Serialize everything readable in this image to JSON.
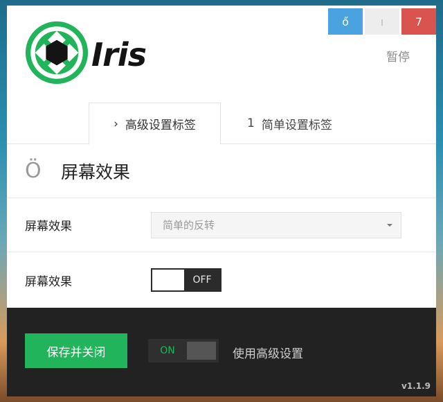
{
  "app": {
    "brand": "Iris"
  },
  "window_buttons": {
    "minimize": "ő",
    "maximize": "ı",
    "close": "7"
  },
  "header": {
    "pause_label": "暂停"
  },
  "tabs": [
    {
      "icon": "›",
      "label": "高级设置标签",
      "active": true
    },
    {
      "icon": "1",
      "label": "简单设置标签",
      "active": false
    }
  ],
  "section": {
    "icon": "Ö",
    "title": "屏幕效果"
  },
  "rows": [
    {
      "label": "屏幕效果",
      "select_value": "简单的反转"
    },
    {
      "label": "屏幕效果",
      "toggle_state": "OFF"
    }
  ],
  "footer": {
    "save_label": "保存并关闭",
    "advanced_toggle": "ON",
    "advanced_label": "使用高级设置",
    "version": "v1.1.9"
  },
  "colors": {
    "accent_green": "#22b45a",
    "close_red": "#d9534f",
    "blue": "#4aa3e0",
    "footer_bg": "#222222"
  }
}
